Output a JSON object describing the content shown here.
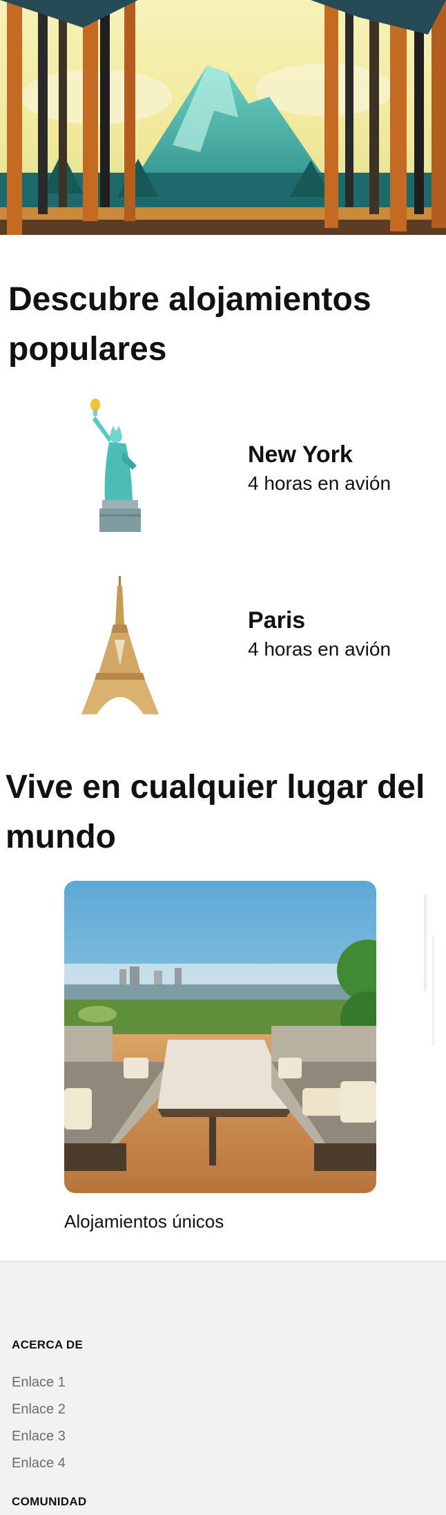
{
  "hero": {
    "image": "mountain-forest-landscape-illustration"
  },
  "popular": {
    "title": "Descubre alojamientos populares",
    "destinations": [
      {
        "name": "New York",
        "subtitle": "4 horas en avión",
        "icon": "statue-of-liberty"
      },
      {
        "name": "Paris",
        "subtitle": "4 horas en avión",
        "icon": "eiffel-tower"
      }
    ]
  },
  "anywhere": {
    "title": "Vive en cualquier lugar del mundo",
    "cards": [
      {
        "label": "Alojamientos únicos",
        "image": "rooftop-terrace-lounge"
      }
    ]
  },
  "footer": {
    "sections": [
      {
        "heading": "ACERCA DE",
        "links": [
          "Enlace 1",
          "Enlace 2",
          "Enlace 3",
          "Enlace 4"
        ]
      },
      {
        "heading": "COMUNIDAD",
        "links": []
      }
    ]
  },
  "colors": {
    "footer_bg": "#f2f2f2",
    "link": "#6b6b6b",
    "text": "#111111"
  }
}
